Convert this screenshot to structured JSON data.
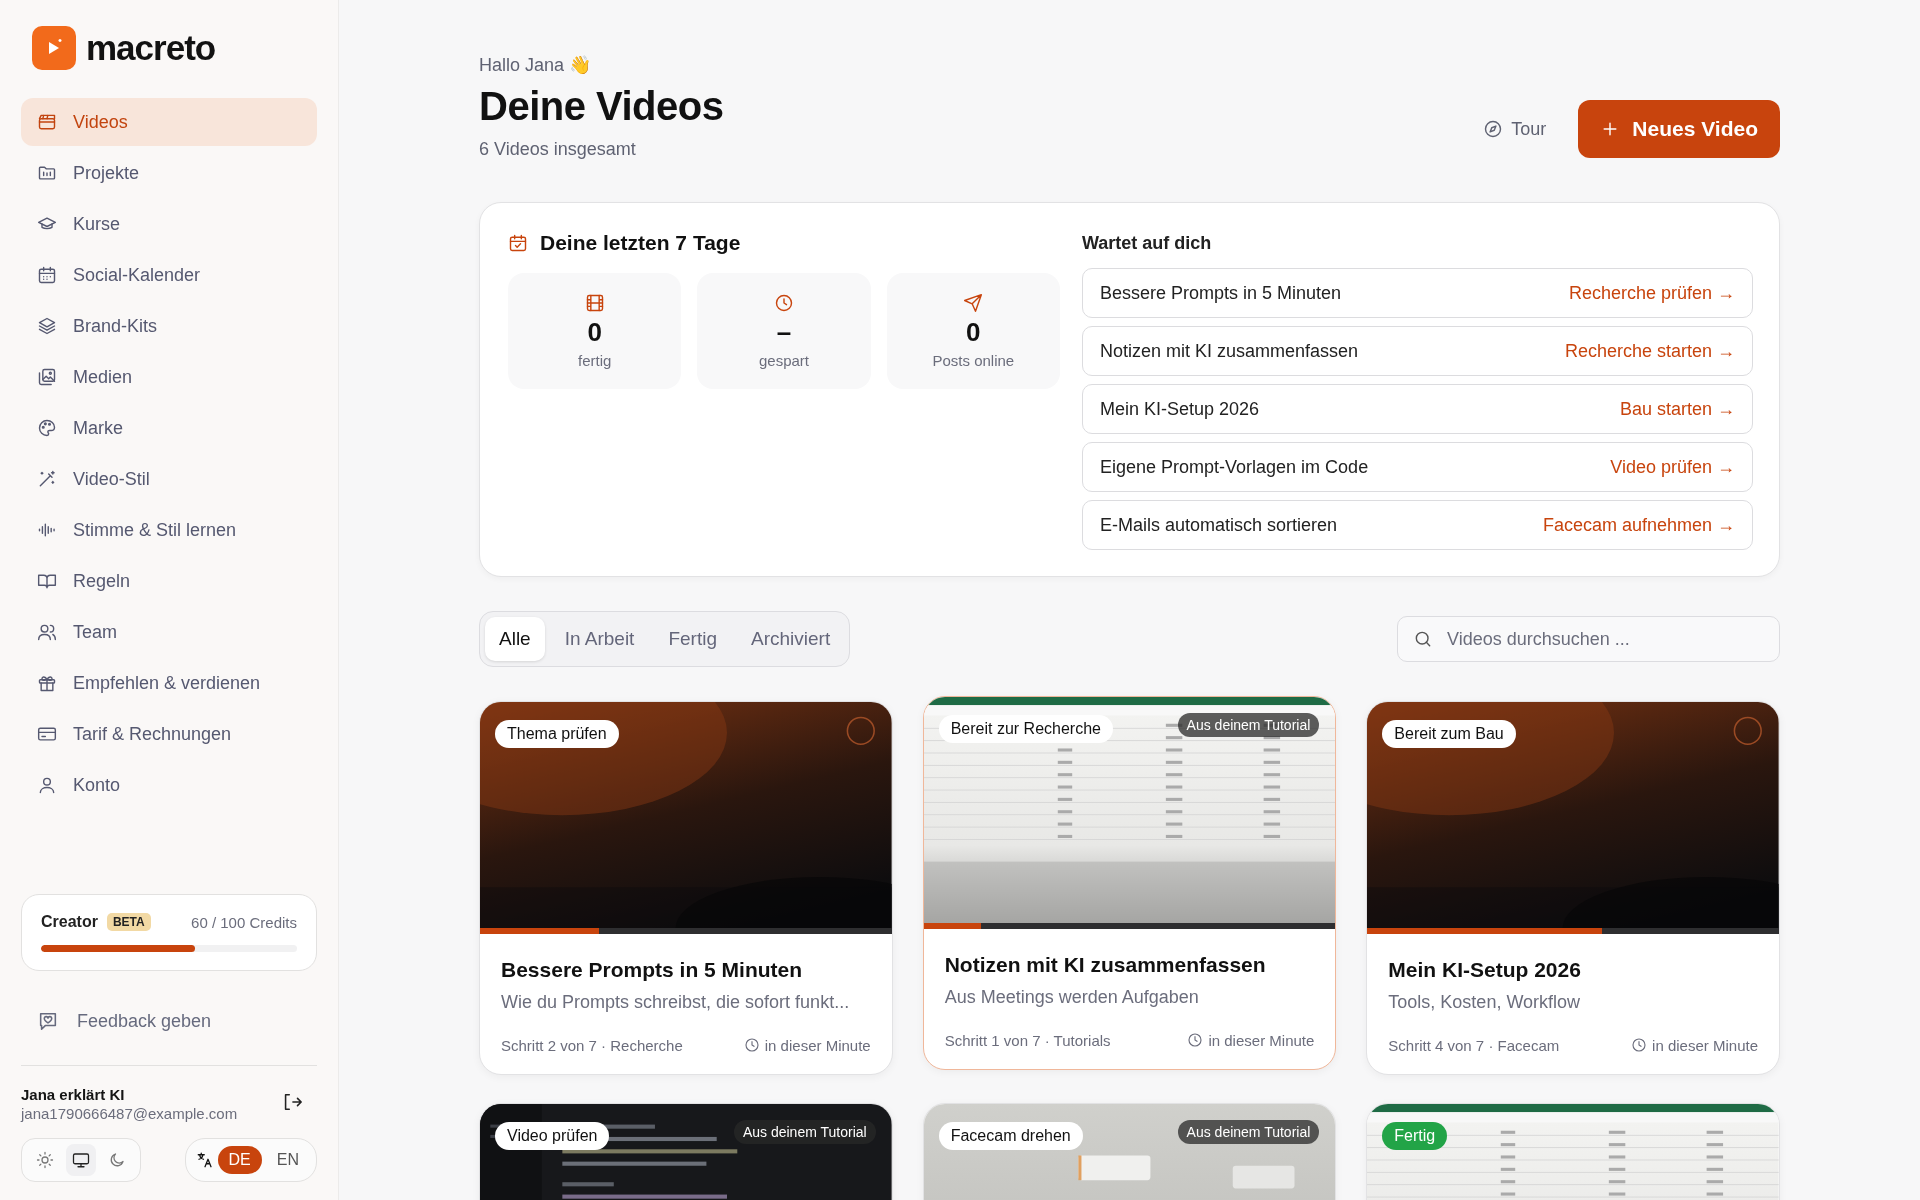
{
  "brand": {
    "name": "macreto"
  },
  "sidebar": {
    "items": [
      {
        "label": "Videos",
        "selected": true
      },
      {
        "label": "Projekte",
        "selected": false
      },
      {
        "label": "Kurse",
        "selected": false
      },
      {
        "label": "Social-Kalender",
        "selected": false
      },
      {
        "label": "Brand-Kits",
        "selected": false
      },
      {
        "label": "Medien",
        "selected": false
      },
      {
        "label": "Marke",
        "selected": false
      },
      {
        "label": "Video-Stil",
        "selected": false
      },
      {
        "label": "Stimme & Stil lernen",
        "selected": false
      },
      {
        "label": "Regeln",
        "selected": false
      },
      {
        "label": "Team",
        "selected": false
      },
      {
        "label": "Empfehlen & verdienen",
        "selected": false
      },
      {
        "label": "Tarif & Rechnungen",
        "selected": false
      },
      {
        "label": "Konto",
        "selected": false
      }
    ],
    "plan": {
      "name": "Creator",
      "badge": "BETA",
      "credits": "60 / 100 Credits",
      "level": 0.6
    },
    "feedback": "Feedback geben",
    "user": {
      "name": "Jana erklärt KI",
      "email": "jana1790666487@example.com"
    },
    "theme_options": [
      {
        "selected": false
      },
      {
        "selected": true
      },
      {
        "selected": false
      }
    ],
    "languages": [
      {
        "label": "DE",
        "selected": true
      },
      {
        "label": "EN",
        "selected": false
      }
    ]
  },
  "header": {
    "greeting": "Hallo Jana 👋",
    "title": "Deine Videos",
    "subtitle": "6 Videos insgesamt",
    "tour": "Tour",
    "new_video": "Neues Video"
  },
  "summary": {
    "title": "Deine letzten 7 Tage",
    "stats": [
      {
        "value": "0",
        "label": "fertig"
      },
      {
        "value": "–",
        "label": "gespart"
      },
      {
        "value": "0",
        "label": "Posts online"
      }
    ],
    "waiting_title": "Wartet auf dich",
    "waiting": [
      {
        "title": "Bessere Prompts in 5 Minuten",
        "action": "Recherche prüfen →"
      },
      {
        "title": "Notizen mit KI zusammenfassen",
        "action": "Recherche starten →"
      },
      {
        "title": "Mein KI-Setup 2026",
        "action": "Bau starten →"
      },
      {
        "title": "Eigene Prompt-Vorlagen im Code",
        "action": "Video prüfen →"
      },
      {
        "title": "E-Mails automatisch sortieren",
        "action": "Facecam aufnehmen →"
      }
    ]
  },
  "filters": [
    {
      "label": "Alle",
      "selected": true
    },
    {
      "label": "In Arbeit",
      "selected": false
    },
    {
      "label": "Fertig",
      "selected": false
    },
    {
      "label": "Archiviert",
      "selected": false
    }
  ],
  "search": {
    "placeholder": "Videos durchsuchen ..."
  },
  "videos": [
    {
      "status": "Thema prüfen",
      "kind": "open",
      "selected": false,
      "level": 0.29,
      "title": "Bessere Prompts in 5 Minuten",
      "subtitle": "Wie du Prompts schreibst, die sofort funkt...",
      "step": "Schritt 2 von 7 · Recherche",
      "time": "in dieser Minute"
    },
    {
      "status": "Bereit zur Recherche",
      "kind": "open",
      "source": "Aus deinem Tutorial",
      "selected": true,
      "level": 0.14,
      "title": "Notizen mit KI zusammenfassen",
      "subtitle": "Aus Meetings werden Aufgaben",
      "step": "Schritt 1 von 7 · Tutorials",
      "time": "in dieser Minute"
    },
    {
      "status": "Bereit zum Bau",
      "kind": "open",
      "selected": false,
      "level": 0.57,
      "title": "Mein KI-Setup 2026",
      "subtitle": "Tools, Kosten, Workflow",
      "step": "Schritt 4 von 7 · Facecam",
      "time": "in dieser Minute"
    },
    {
      "status": "Video prüfen",
      "kind": "open",
      "source": "Aus deinem Tutorial",
      "selected": false
    },
    {
      "status": "Facecam drehen",
      "kind": "open",
      "source": "Aus deinem Tutorial",
      "selected": false
    },
    {
      "status": "Fertig",
      "kind": "done",
      "selected": false
    }
  ]
}
